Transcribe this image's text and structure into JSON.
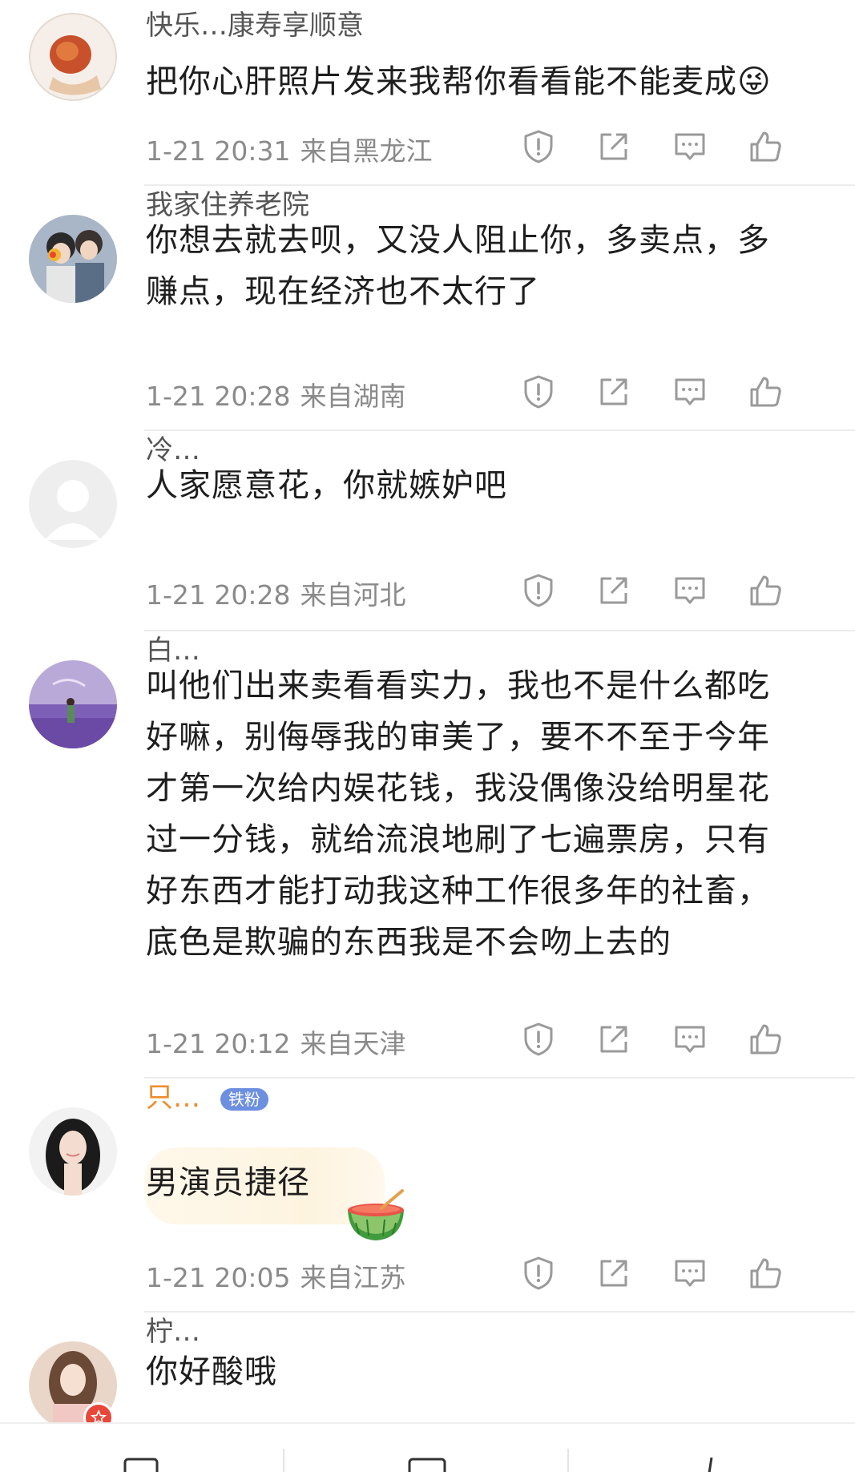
{
  "colors": {
    "text": "#1e1e1e",
    "meta": "#8a8a8a",
    "icon": "#9a9a9a",
    "divider": "#ececec",
    "orange_name": "#f08a2a"
  },
  "comments": [
    {
      "username": "快乐…康寿享顺意",
      "text_lines": [
        "把你心肝照片发来我帮你看看能不能麦成😜"
      ],
      "date": "1-21 20:31",
      "location": "来自黑龙江"
    },
    {
      "username": "我家住养老院",
      "text_lines": [
        "你想去就去呗，又没人阻止你，多卖点，多",
        "赚点，现在经济也不太行了"
      ],
      "date": "1-21 20:28",
      "location": "来自湖南"
    },
    {
      "username": "冷…",
      "text_lines": [
        "人家愿意花，你就嫉妒吧"
      ],
      "date": "1-21 20:28",
      "location": "来自河北"
    },
    {
      "username": "白…",
      "text_lines": [
        "叫他们出来卖看看实力，我也不是什么都吃",
        "好嘛，别侮辱我的审美了，要不不至于今年",
        "才第一次给内娱花钱，我没偶像没给明星花",
        "过一分钱，就给流浪地刷了七遍票房，只有",
        "好东西才能打动我这种工作很多年的社畜，",
        "底色是欺骗的东西我是不会吻上去的"
      ],
      "date": "1-21 20:12",
      "location": "来自天津"
    },
    {
      "username": "只…",
      "badge": "铁粉",
      "text_lines": [
        "男演员捷径"
      ],
      "date": "1-21 20:05",
      "location": "来自江苏"
    },
    {
      "username": "柠…",
      "text_lines": [
        "你好酸哦"
      ],
      "date": "",
      "location": ""
    }
  ],
  "icons": {
    "report": "report-shield-icon",
    "share": "share-external-icon",
    "reply": "comment-bubble-icon",
    "like": "thumbs-up-icon"
  }
}
